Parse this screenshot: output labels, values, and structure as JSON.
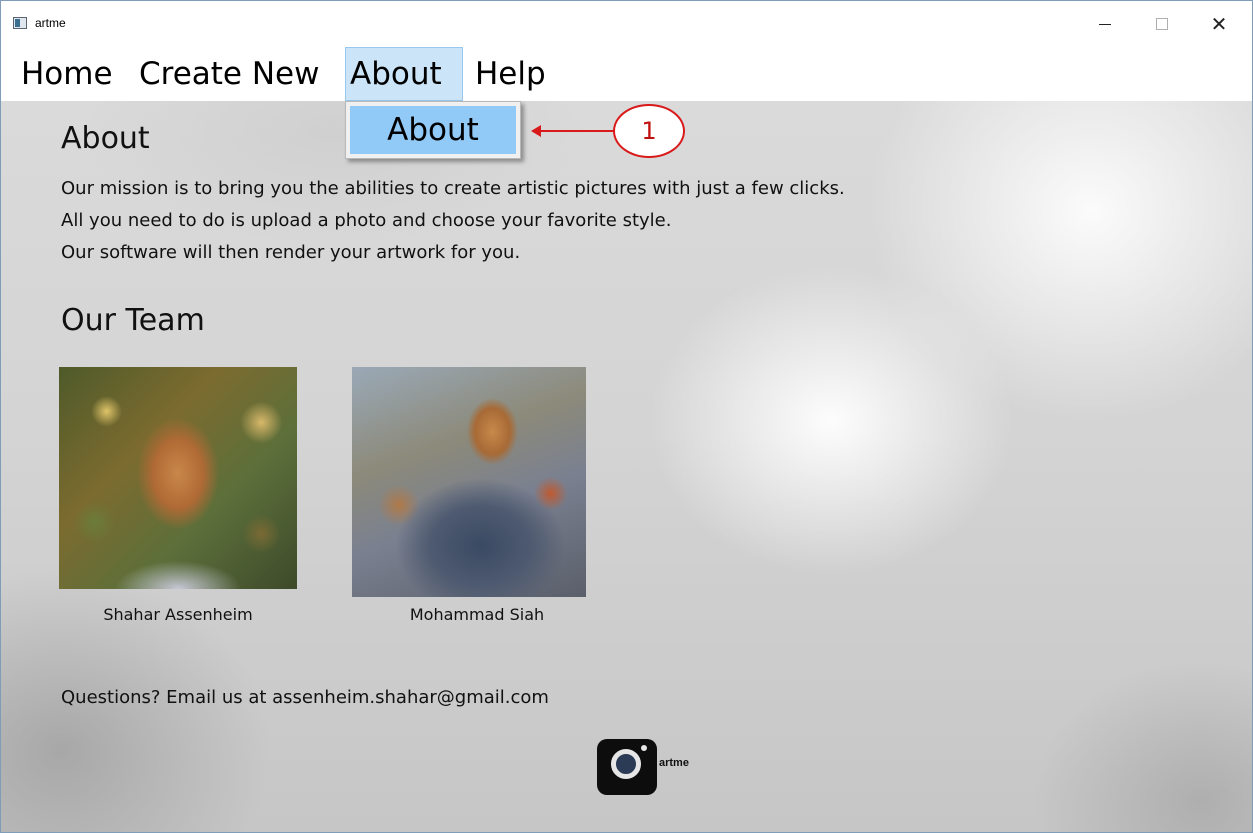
{
  "window": {
    "title": "artme",
    "controls": {
      "minimize": "—",
      "maximize": "☐",
      "close": "✕"
    }
  },
  "menubar": {
    "items": [
      {
        "label": "Home"
      },
      {
        "label": "Create New"
      },
      {
        "label": "About"
      },
      {
        "label": "Help"
      }
    ]
  },
  "dropdown": {
    "items": [
      {
        "label": "About"
      }
    ]
  },
  "annotation": {
    "label": "1",
    "color": "#d91a1a"
  },
  "about": {
    "heading": "About",
    "lines": [
      "Our mission is to bring you the abilities to create artistic pictures with just a few clicks.",
      "All you need to do is upload a photo and choose your favorite style.",
      "Our software will then render your artwork for you."
    ]
  },
  "team": {
    "heading": "Our Team",
    "members": [
      {
        "name": "Shahar Assenheim"
      },
      {
        "name": "Mohammad Siah"
      }
    ]
  },
  "contact": {
    "text": "Questions? Email us at assenheim.shahar@gmail.com"
  },
  "logo": {
    "text": "artme",
    "icon": "camera-icon"
  },
  "colors": {
    "menu_highlight": "#cce4f7",
    "dropdown_highlight": "#91c9f7"
  }
}
